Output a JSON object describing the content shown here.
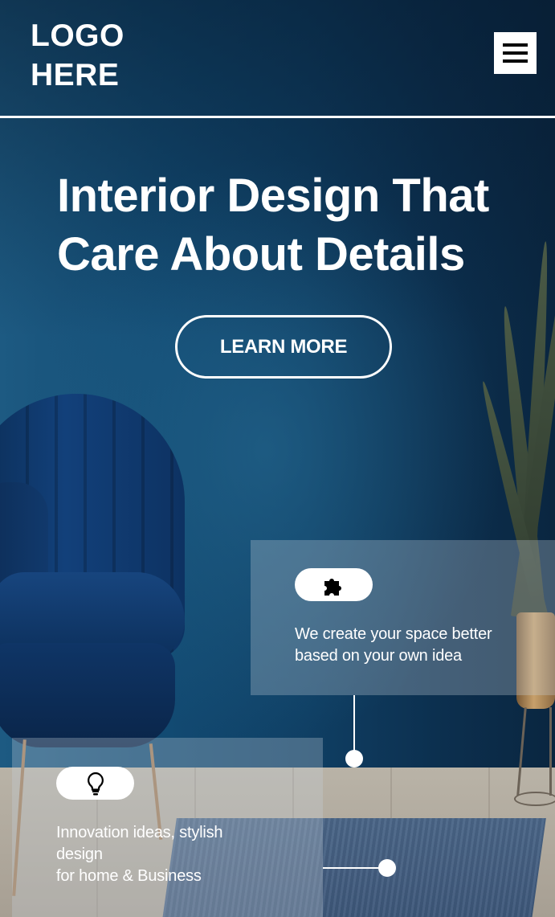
{
  "header": {
    "logo_text": "LOGO\nHERE",
    "menu_icon": "hamburger-menu-icon"
  },
  "hero": {
    "title": "Interior Design That Care About Details",
    "cta_label": "LEARN MORE"
  },
  "features": [
    {
      "icon": "puzzle-piece-icon",
      "text": "We create your space better\nbased on your own idea"
    },
    {
      "icon": "lightbulb-icon",
      "text": "Innovation ideas, stylish\ndesign\nfor home & Business"
    }
  ],
  "colors": {
    "wall": "#124a72",
    "text": "#ffffff",
    "button_border": "#ffffff",
    "card_overlay": "rgba(200,210,220,0.30)"
  }
}
